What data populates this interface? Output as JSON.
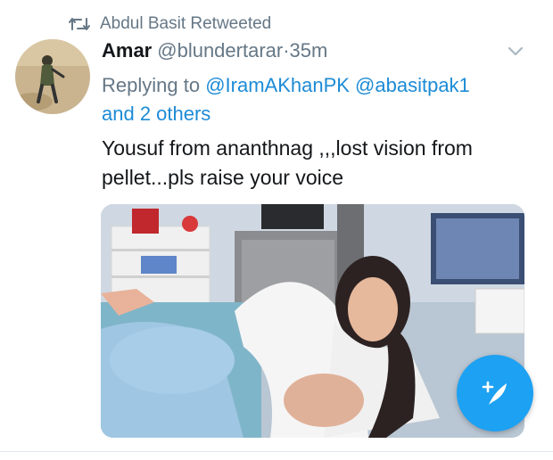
{
  "retweet": {
    "text": "Abdul Basit Retweeted"
  },
  "tweet": {
    "display_name": "Amar",
    "handle": "@blundertarar",
    "separator": " · ",
    "time": "35m",
    "replying_to_prefix": "Replying to ",
    "mention_1": "@IramAKhanPK",
    "mention_2": "@abasitpak1",
    "and_others": "and 2 others",
    "text_line_1": "Yousuf from ananthnag ,,,lost vision from",
    "text_line_2": "pellet...pls raise your voice"
  },
  "colors": {
    "accent": "#1da1f2",
    "mention": "#1d8bd6",
    "secondary_text": "#657786"
  },
  "icons": {
    "retweet": "retweet-icon",
    "menu": "chevron-down-icon",
    "compose": "compose-tweet-icon"
  }
}
